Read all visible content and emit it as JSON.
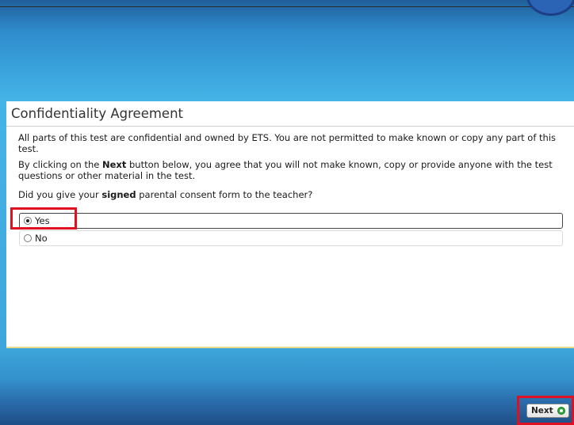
{
  "page": {
    "title": "Confidentiality Agreement"
  },
  "agreement": {
    "para1": "All parts of this test are confidential and owned by ETS. You are not permitted to make known or copy any part of this test.",
    "para2_before": "By clicking on the ",
    "para2_bold": "Next",
    "para2_after": " button below, you agree that you will not make known, copy or provide anyone with the test questions or other material in the test.",
    "question_before": "Did you give your ",
    "question_bold": "signed",
    "question_after": " parental consent form to the teacher?"
  },
  "options": [
    {
      "label": "Yes",
      "selected": true
    },
    {
      "label": "No",
      "selected": false
    }
  ],
  "footer": {
    "next_label": "Next",
    "next_icon": "green-circle-arrow-icon"
  },
  "colors": {
    "highlight": "#e01020",
    "background_blue": "#3aa3dc"
  }
}
